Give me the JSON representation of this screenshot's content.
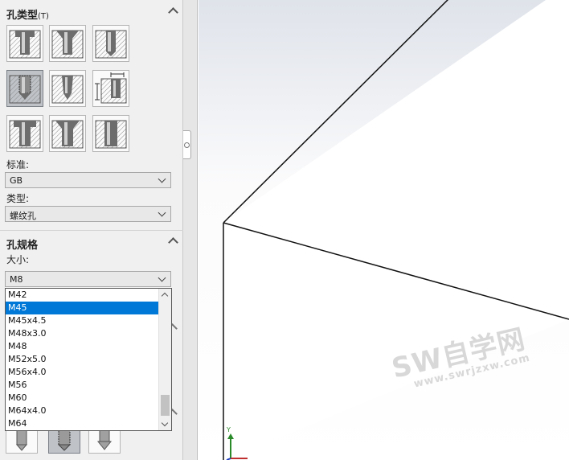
{
  "hole_type_section": {
    "title": "孔类型",
    "shortcut": "(T)"
  },
  "hole_type_buttons": [
    {
      "icon": "counterbore-icon",
      "selected": false
    },
    {
      "icon": "countersink-icon",
      "selected": false
    },
    {
      "icon": "simple-hole-icon",
      "selected": false
    },
    {
      "icon": "straight-tap-icon",
      "selected": true
    },
    {
      "icon": "tapered-tap-icon",
      "selected": false
    },
    {
      "icon": "legacy-hole-icon",
      "selected": false
    },
    {
      "icon": "counterbore-slot-icon",
      "selected": false
    },
    {
      "icon": "countersink-slot-icon",
      "selected": false
    },
    {
      "icon": "straight-slot-icon",
      "selected": false
    }
  ],
  "standard": {
    "label": "标准:",
    "value": "GB"
  },
  "type": {
    "label": "类型:",
    "value": "螺纹孔"
  },
  "hole_spec_section": {
    "title": "孔规格"
  },
  "size": {
    "label": "大小:",
    "value": "M8",
    "options": [
      "M42",
      "M45",
      "M45x4.5",
      "M48x3.0",
      "M48",
      "M52x5.0",
      "M56x4.0",
      "M56",
      "M60",
      "M64x4.0",
      "M64"
    ],
    "highlighted": "M45"
  },
  "watermark": {
    "text": "SW自学网",
    "url": "www.swrjzxw.com"
  },
  "triad": {
    "y_label": "Y"
  },
  "colors": {
    "selection": "#0078d7",
    "panel": "#f0f0f0"
  }
}
